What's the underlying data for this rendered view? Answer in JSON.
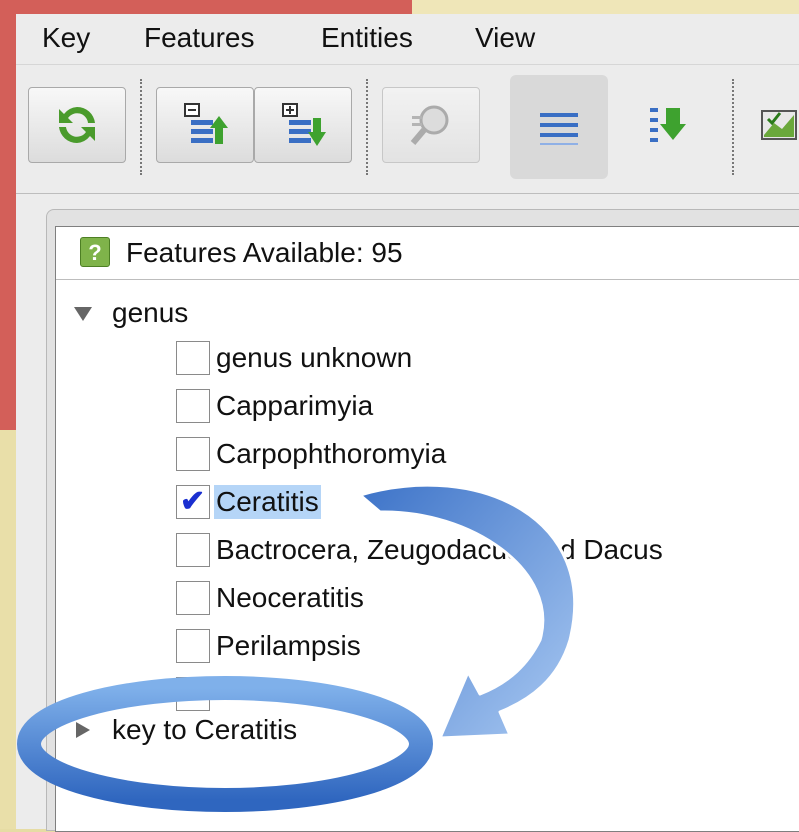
{
  "menu": [
    "Key",
    "Features",
    "Entities",
    "View"
  ],
  "toolbar": {
    "icons": [
      "refresh-icon",
      "collapse-up-icon",
      "expand-down-icon",
      "search-magnifier-icon",
      "list-lines-icon",
      "list-down-icon",
      "chart-icon"
    ]
  },
  "features_panel": {
    "title": "Features Available: 95",
    "help_glyph": "?"
  },
  "tree": {
    "genus_label": "genus",
    "options": [
      {
        "label": "genus unknown",
        "checked": false
      },
      {
        "label": "Capparimyia",
        "checked": false
      },
      {
        "label": "Carpophthoromyia",
        "checked": false
      },
      {
        "label": "Ceratitis",
        "checked": true
      },
      {
        "label": "Bactrocera, Zeugodacus and Dacus",
        "checked": false
      },
      {
        "label": "Neoceratitis",
        "checked": false
      },
      {
        "label": "Perilampsis",
        "checked": false
      }
    ],
    "key_label": "key to Ceratitis",
    "check_glyph": "✔"
  },
  "colors": {
    "accent_red": "#d35f59",
    "selection": "#b5d5f7",
    "arrow_blue": "#5b8fd6"
  }
}
